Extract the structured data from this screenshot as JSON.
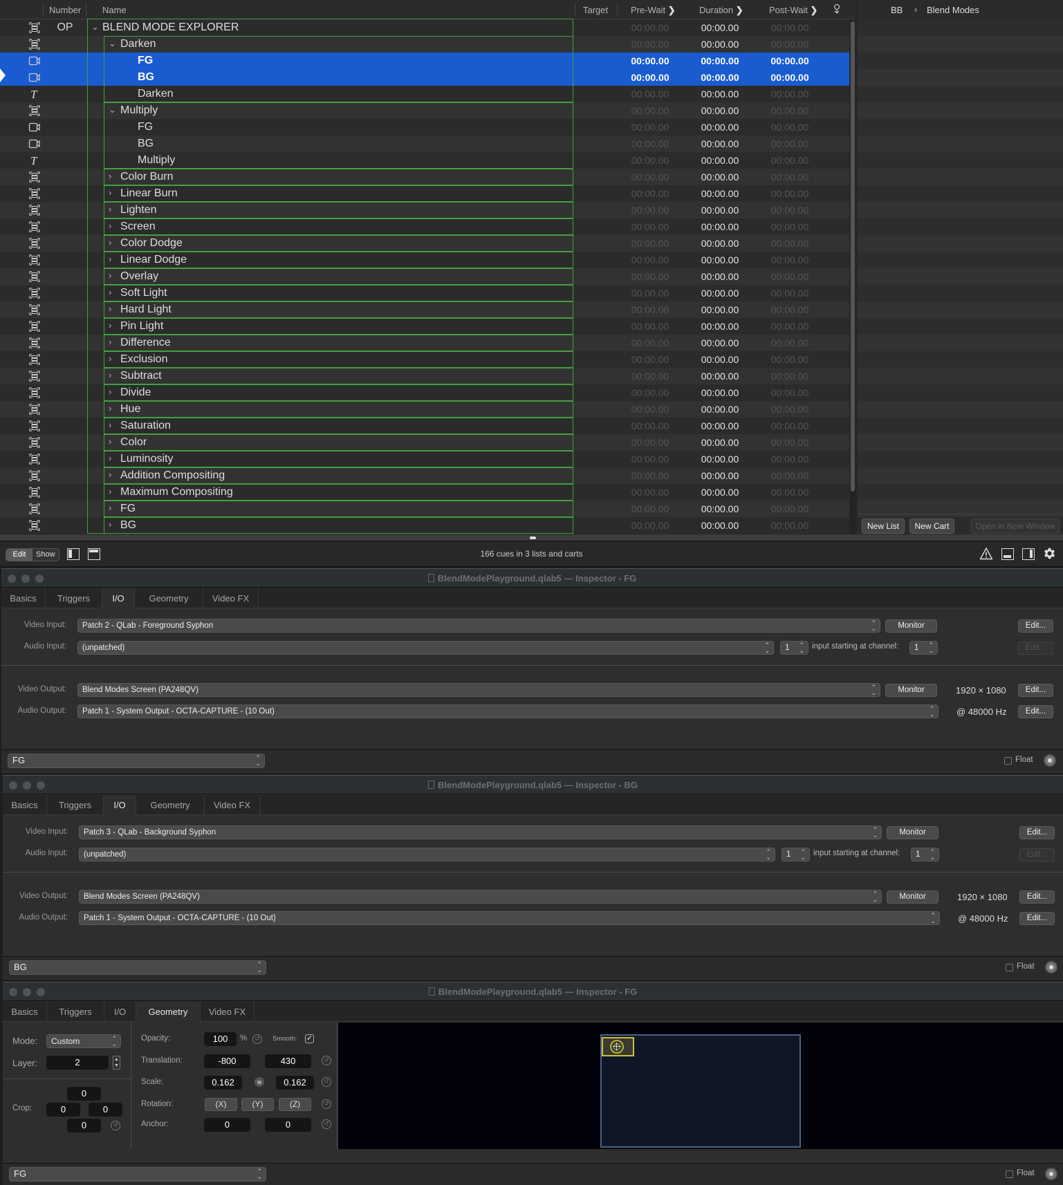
{
  "cuelist": {
    "columns": {
      "number": "Number",
      "name": "Name",
      "target": "Target",
      "prewait": "Pre-Wait",
      "duration": "Duration",
      "postwait": "Post-Wait"
    },
    "rows": [
      {
        "icon": "group",
        "number": "OP",
        "name": "BLEND MODE EXPLORER",
        "level": 0,
        "expand": "open",
        "pre": "00:00.00",
        "dur": "00:00.00",
        "post": "00:00.00",
        "selected": false
      },
      {
        "icon": "group",
        "number": "",
        "name": "Darken",
        "level": 1,
        "expand": "open",
        "pre": "00:00.00",
        "dur": "00:00.00",
        "post": "00:00.00",
        "selected": false
      },
      {
        "icon": "video",
        "number": "",
        "name": "FG",
        "level": 2,
        "expand": "",
        "pre": "00:00.00",
        "dur": "00:00.00",
        "post": "00:00.00",
        "selected": true
      },
      {
        "icon": "video",
        "number": "",
        "name": "BG",
        "level": 2,
        "expand": "",
        "pre": "00:00.00",
        "dur": "00:00.00",
        "post": "00:00.00",
        "selected": true
      },
      {
        "icon": "text",
        "number": "",
        "name": "Darken",
        "level": 2,
        "expand": "",
        "pre": "00:00.00",
        "dur": "00:00.00",
        "post": "00:00.00",
        "selected": false
      },
      {
        "icon": "group",
        "number": "",
        "name": "Multiply",
        "level": 1,
        "expand": "open",
        "pre": "00:00.00",
        "dur": "00:00.00",
        "post": "00:00.00",
        "selected": false
      },
      {
        "icon": "video",
        "number": "",
        "name": "FG",
        "level": 2,
        "expand": "",
        "pre": "00:00.00",
        "dur": "00:00.00",
        "post": "00:00.00",
        "selected": false
      },
      {
        "icon": "video",
        "number": "",
        "name": "BG",
        "level": 2,
        "expand": "",
        "pre": "00:00.00",
        "dur": "00:00.00",
        "post": "00:00.00",
        "selected": false
      },
      {
        "icon": "text",
        "number": "",
        "name": "Multiply",
        "level": 2,
        "expand": "",
        "pre": "00:00.00",
        "dur": "00:00.00",
        "post": "00:00.00",
        "selected": false
      },
      {
        "icon": "group",
        "number": "",
        "name": "Color Burn",
        "level": 1,
        "expand": "closed",
        "pre": "00:00.00",
        "dur": "00:00.00",
        "post": "00:00.00",
        "selected": false
      },
      {
        "icon": "group",
        "number": "",
        "name": "Linear Burn",
        "level": 1,
        "expand": "closed",
        "pre": "00:00.00",
        "dur": "00:00.00",
        "post": "00:00.00",
        "selected": false
      },
      {
        "icon": "group",
        "number": "",
        "name": "Lighten",
        "level": 1,
        "expand": "closed",
        "pre": "00:00.00",
        "dur": "00:00.00",
        "post": "00:00.00",
        "selected": false
      },
      {
        "icon": "group",
        "number": "",
        "name": "Screen",
        "level": 1,
        "expand": "closed",
        "pre": "00:00.00",
        "dur": "00:00.00",
        "post": "00:00.00",
        "selected": false
      },
      {
        "icon": "group",
        "number": "",
        "name": "Color Dodge",
        "level": 1,
        "expand": "closed",
        "pre": "00:00.00",
        "dur": "00:00.00",
        "post": "00:00.00",
        "selected": false
      },
      {
        "icon": "group",
        "number": "",
        "name": "Linear Dodge",
        "level": 1,
        "expand": "closed",
        "pre": "00:00.00",
        "dur": "00:00.00",
        "post": "00:00.00",
        "selected": false
      },
      {
        "icon": "group",
        "number": "",
        "name": "Overlay",
        "level": 1,
        "expand": "closed",
        "pre": "00:00.00",
        "dur": "00:00.00",
        "post": "00:00.00",
        "selected": false
      },
      {
        "icon": "group",
        "number": "",
        "name": "Soft Light",
        "level": 1,
        "expand": "closed",
        "pre": "00:00.00",
        "dur": "00:00.00",
        "post": "00:00.00",
        "selected": false
      },
      {
        "icon": "group",
        "number": "",
        "name": "Hard Light",
        "level": 1,
        "expand": "closed",
        "pre": "00:00.00",
        "dur": "00:00.00",
        "post": "00:00.00",
        "selected": false
      },
      {
        "icon": "group",
        "number": "",
        "name": "Pin Light",
        "level": 1,
        "expand": "closed",
        "pre": "00:00.00",
        "dur": "00:00.00",
        "post": "00:00.00",
        "selected": false
      },
      {
        "icon": "group",
        "number": "",
        "name": "Difference",
        "level": 1,
        "expand": "closed",
        "pre": "00:00.00",
        "dur": "00:00.00",
        "post": "00:00.00",
        "selected": false
      },
      {
        "icon": "group",
        "number": "",
        "name": "Exclusion",
        "level": 1,
        "expand": "closed",
        "pre": "00:00.00",
        "dur": "00:00.00",
        "post": "00:00.00",
        "selected": false
      },
      {
        "icon": "group",
        "number": "",
        "name": "Subtract",
        "level": 1,
        "expand": "closed",
        "pre": "00:00.00",
        "dur": "00:00.00",
        "post": "00:00.00",
        "selected": false
      },
      {
        "icon": "group",
        "number": "",
        "name": "Divide",
        "level": 1,
        "expand": "closed",
        "pre": "00:00.00",
        "dur": "00:00.00",
        "post": "00:00.00",
        "selected": false
      },
      {
        "icon": "group",
        "number": "",
        "name": "Hue",
        "level": 1,
        "expand": "closed",
        "pre": "00:00.00",
        "dur": "00:00.00",
        "post": "00:00.00",
        "selected": false
      },
      {
        "icon": "group",
        "number": "",
        "name": "Saturation",
        "level": 1,
        "expand": "closed",
        "pre": "00:00.00",
        "dur": "00:00.00",
        "post": "00:00.00",
        "selected": false
      },
      {
        "icon": "group",
        "number": "",
        "name": "Color",
        "level": 1,
        "expand": "closed",
        "pre": "00:00.00",
        "dur": "00:00.00",
        "post": "00:00.00",
        "selected": false
      },
      {
        "icon": "group",
        "number": "",
        "name": "Luminosity",
        "level": 1,
        "expand": "closed",
        "pre": "00:00.00",
        "dur": "00:00.00",
        "post": "00:00.00",
        "selected": false
      },
      {
        "icon": "group",
        "number": "",
        "name": "Addition Compositing",
        "level": 1,
        "expand": "closed",
        "pre": "00:00.00",
        "dur": "00:00.00",
        "post": "00:00.00",
        "selected": false
      },
      {
        "icon": "group",
        "number": "",
        "name": "Maximum Compositing",
        "level": 1,
        "expand": "closed",
        "pre": "00:00.00",
        "dur": "00:00.00",
        "post": "00:00.00",
        "selected": false
      },
      {
        "icon": "group",
        "number": "",
        "name": "FG",
        "level": 1,
        "expand": "closed",
        "pre": "00:00.00",
        "dur": "00:00.00",
        "post": "00:00.00",
        "selected": false
      },
      {
        "icon": "group",
        "number": "",
        "name": "BG",
        "level": 1,
        "expand": "closed",
        "pre": "00:00.00",
        "dur": "00:00.00",
        "post": "00:00.00",
        "selected": false
      }
    ]
  },
  "lists_panel": {
    "header_number": "BB",
    "header_name": "Blend Modes",
    "new_list": "New List",
    "new_cart": "New Cart",
    "open_new_window": "Open in New Window"
  },
  "toolbar": {
    "edit": "Edit",
    "show": "Show",
    "status": "166 cues in 3 lists and carts"
  },
  "inspectors": [
    {
      "title": "BlendModePlayground.qlab5 — Inspector - FG",
      "tabs": [
        "Basics",
        "Triggers",
        "I/O",
        "Geometry",
        "Video FX"
      ],
      "active_tab": "I/O",
      "video_input_label": "Video Input:",
      "video_input": "Patch 2 - QLab - Foreground Syphon",
      "audio_input_label": "Audio Input:",
      "audio_input": "(unpatched)",
      "audio_input_count": "1",
      "channel_label": "input starting at channel:",
      "channel": "1",
      "video_output_label": "Video Output:",
      "video_output": "Blend Modes Screen (PA248QV)",
      "resolution": "1920 × 1080",
      "audio_output_label": "Audio Output:",
      "audio_output": "Patch 1 - System Output - OCTA-CAPTURE - (10 Out)",
      "sample_rate": "@ 48000 Hz",
      "monitor": "Monitor",
      "edit": "Edit...",
      "cue_select": "FG",
      "float": "Float"
    },
    {
      "title": "BlendModePlayground.qlab5 — Inspector - BG",
      "tabs": [
        "Basics",
        "Triggers",
        "I/O",
        "Geometry",
        "Video FX"
      ],
      "active_tab": "I/O",
      "video_input_label": "Video Input:",
      "video_input": "Patch 3 - QLab - Background Syphon",
      "audio_input_label": "Audio Input:",
      "audio_input": "(unpatched)",
      "audio_input_count": "1",
      "channel_label": "input starting at channel:",
      "channel": "1",
      "video_output_label": "Video Output:",
      "video_output": "Blend Modes Screen (PA248QV)",
      "resolution": "1920 × 1080",
      "audio_output_label": "Audio Output:",
      "audio_output": "Patch 1 - System Output - OCTA-CAPTURE - (10 Out)",
      "sample_rate": "@ 48000 Hz",
      "monitor": "Monitor",
      "edit": "Edit...",
      "cue_select": "BG",
      "float": "Float"
    },
    {
      "title": "BlendModePlayground.qlab5 — Inspector - FG",
      "tabs": [
        "Basics",
        "Triggers",
        "I/O",
        "Geometry",
        "Video FX"
      ],
      "active_tab": "Geometry",
      "mode_label": "Mode:",
      "mode": "Custom",
      "layer_label": "Layer:",
      "layer": "2",
      "crop_label": "Crop:",
      "crop_top": "0",
      "crop_left": "0",
      "crop_right": "0",
      "crop_bottom": "0",
      "opacity_label": "Opacity:",
      "opacity": "100",
      "opacity_unit": "%",
      "smooth_label": "Smooth:",
      "smooth_checked": true,
      "translation_label": "Translation:",
      "translation_x": "-800",
      "translation_y": "430",
      "scale_label": "Scale:",
      "scale_x": "0.162",
      "scale_y": "0.162",
      "rotation_label": "Rotation:",
      "rotation_x": "(X)",
      "rotation_y": "(Y)",
      "rotation_z": "(Z)",
      "anchor_label": "Anchor:",
      "anchor_x": "0",
      "anchor_y": "0",
      "cue_select": "FG",
      "float": "Float"
    }
  ],
  "colors": {
    "selection": "#1a5bd0",
    "group_outline": "#3fa33a",
    "stage_preview_bg": "#000008",
    "stage_outline": "#4a6288",
    "layer_highlight": "#c8c040"
  }
}
